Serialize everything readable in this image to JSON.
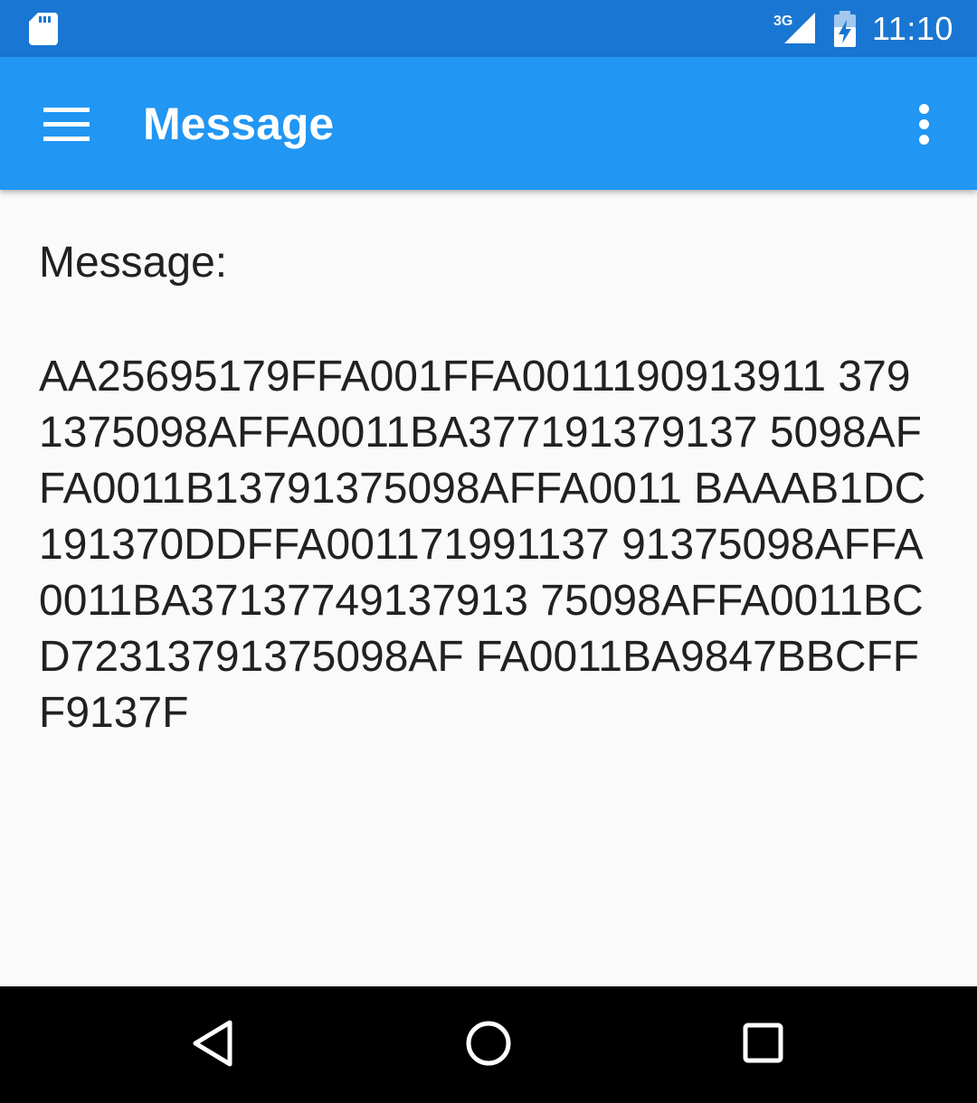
{
  "status_bar": {
    "network_type": "3G",
    "time": "11:10",
    "icons": [
      "sd-card-icon",
      "signal-icon",
      "battery-charging-icon"
    ]
  },
  "app_bar": {
    "title": "Message",
    "icons": [
      "menu-icon",
      "more-vert-icon"
    ],
    "color": "#2196f3"
  },
  "content": {
    "label": "Message:",
    "body": "AA25695179FFA001FFA0011190913911 3791375098AFFA0011BA377191379137 5098AFFA0011B13791375098AFFA0011 BAAAB1DC191370DDFFA001171991137 91375098AFFA0011BA37137749137913 75098AFFA0011BCD72313791375098AF FA0011BA9847BBCFFF9137F"
  },
  "nav_bar": {
    "icons": [
      "back-icon",
      "home-icon",
      "recents-icon"
    ]
  }
}
